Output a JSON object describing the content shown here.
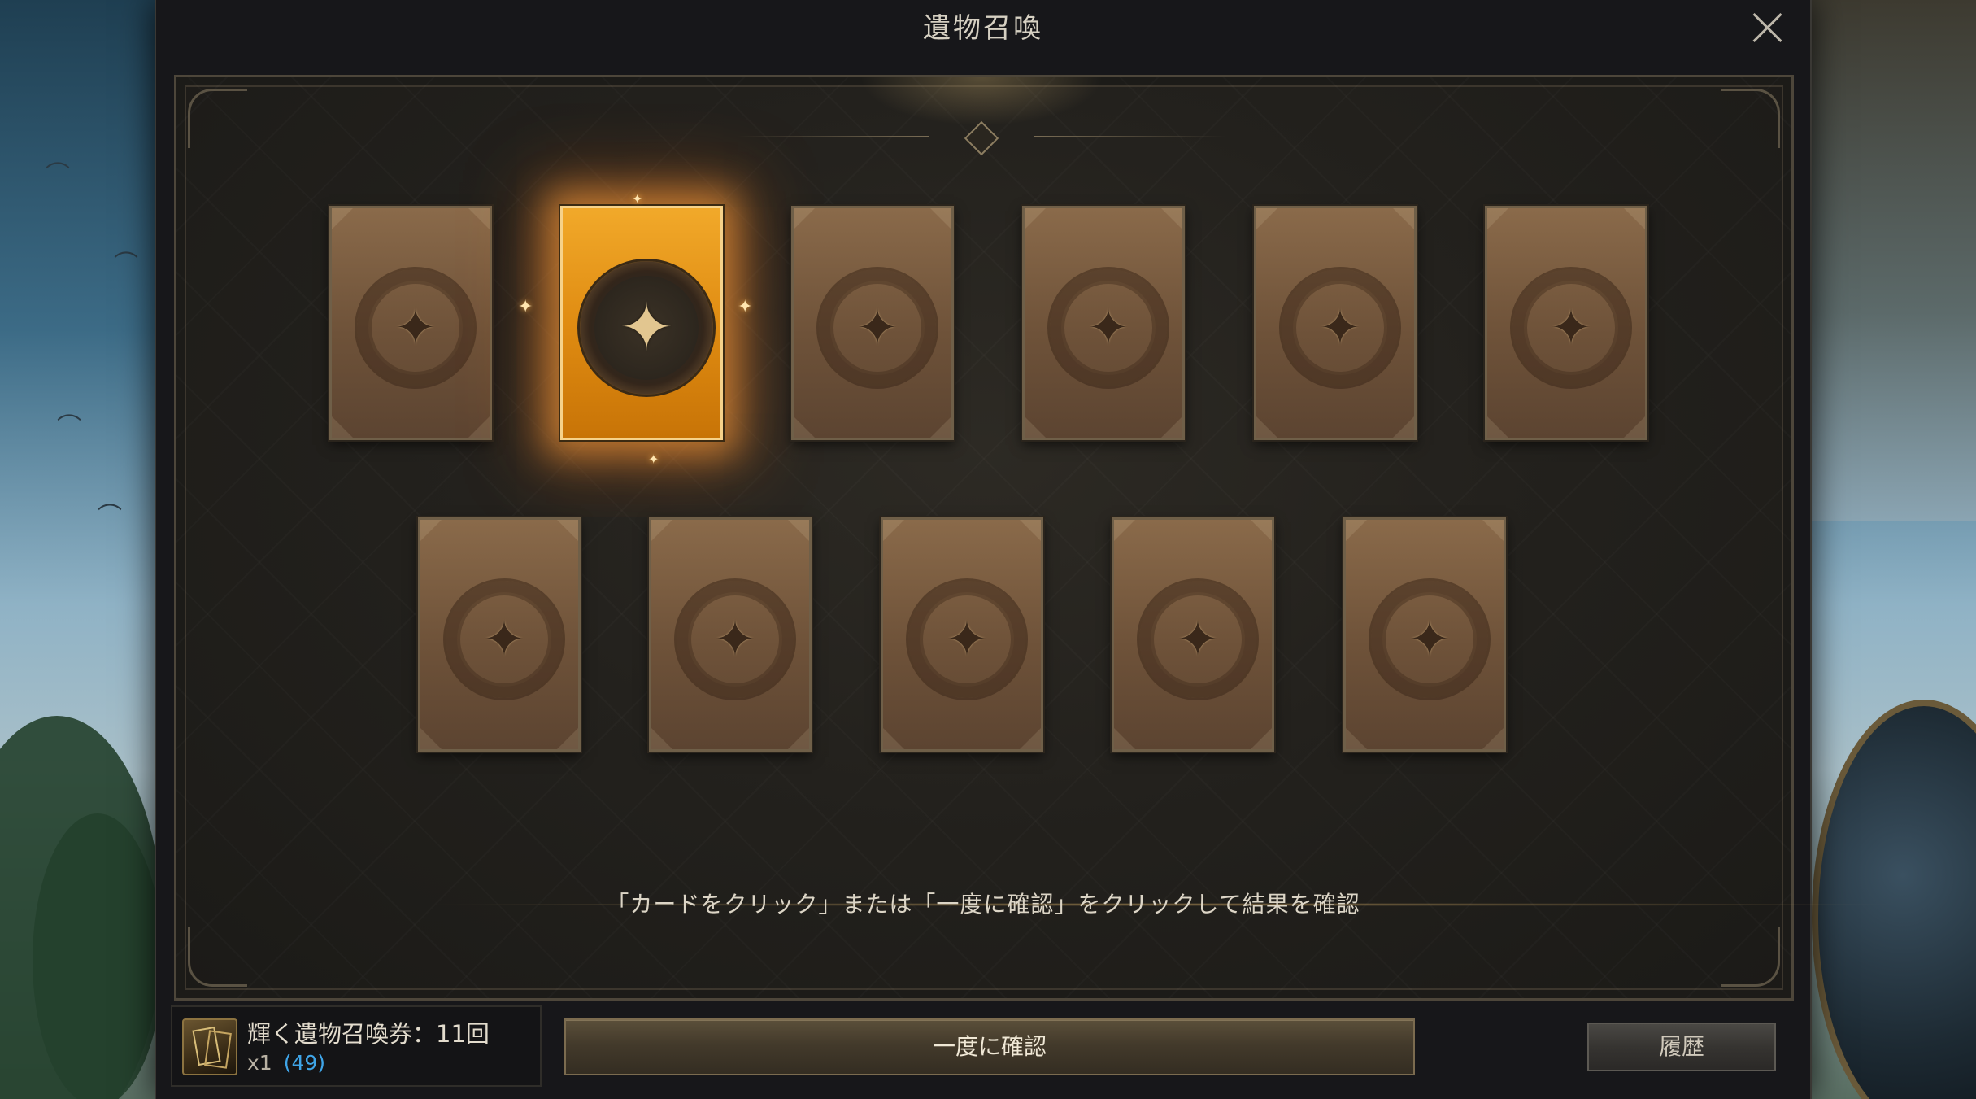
{
  "window": {
    "title": "遺物召喚"
  },
  "cards": {
    "count": 11,
    "selected_index": 1
  },
  "instruction": "「カードをクリック」または「一度に確認」をクリックして結果を確認",
  "ticket": {
    "name": "輝く遺物召喚券：11回",
    "quantity": "x1",
    "owned": "(49)",
    "owned_color": "#3fa5e8"
  },
  "buttons": {
    "confirm_all": "一度に確認",
    "history": "履歴"
  },
  "colors": {
    "selected_card": "#e08c12",
    "card_back": "#6e5239",
    "panel": "#23211d"
  }
}
